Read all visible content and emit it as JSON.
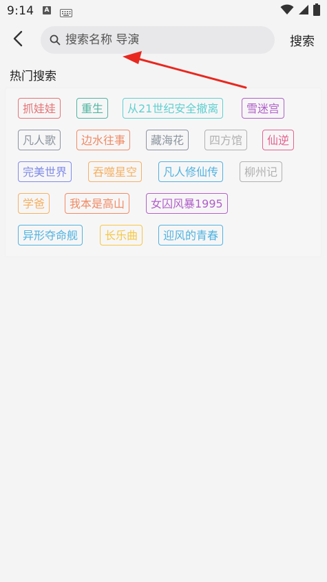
{
  "status_bar": {
    "time": "9:14",
    "a_icon_letter": "A"
  },
  "header": {
    "search_placeholder": "搜索名称 导演",
    "search_button_label": "搜索"
  },
  "section": {
    "title": "热门搜索"
  },
  "tags": [
    {
      "label": "抓娃娃",
      "color": "#e57373"
    },
    {
      "label": "重生",
      "color": "#4db6a0"
    },
    {
      "label": "从21世纪安全撤离",
      "color": "#5fd0d0"
    },
    {
      "label": "雪迷宫",
      "color": "#b05fc9"
    },
    {
      "label": "凡人歌",
      "color": "#8a949e"
    },
    {
      "label": "边水往事",
      "color": "#f08a63"
    },
    {
      "label": "藏海花",
      "color": "#8a949e"
    },
    {
      "label": "四方馆",
      "color": "#b0b0b0"
    },
    {
      "label": "仙逆",
      "color": "#e5608e"
    },
    {
      "label": "完美世界",
      "color": "#7e8be8"
    },
    {
      "label": "吞噬星空",
      "color": "#f5b060"
    },
    {
      "label": "凡人修仙传",
      "color": "#4fb3e0"
    },
    {
      "label": "柳州记",
      "color": "#b0b0b0"
    },
    {
      "label": "学爸",
      "color": "#f5b060"
    },
    {
      "label": "我本是高山",
      "color": "#f08a63"
    },
    {
      "label": "女囚风暴1995",
      "color": "#b05fc9"
    },
    {
      "label": "异形夺命舰",
      "color": "#4fb3e0"
    },
    {
      "label": "长乐曲",
      "color": "#f5c842"
    },
    {
      "label": "迎风的青春",
      "color": "#4fb3e0"
    }
  ],
  "annotation": {
    "arrow_color": "#e8281e"
  }
}
